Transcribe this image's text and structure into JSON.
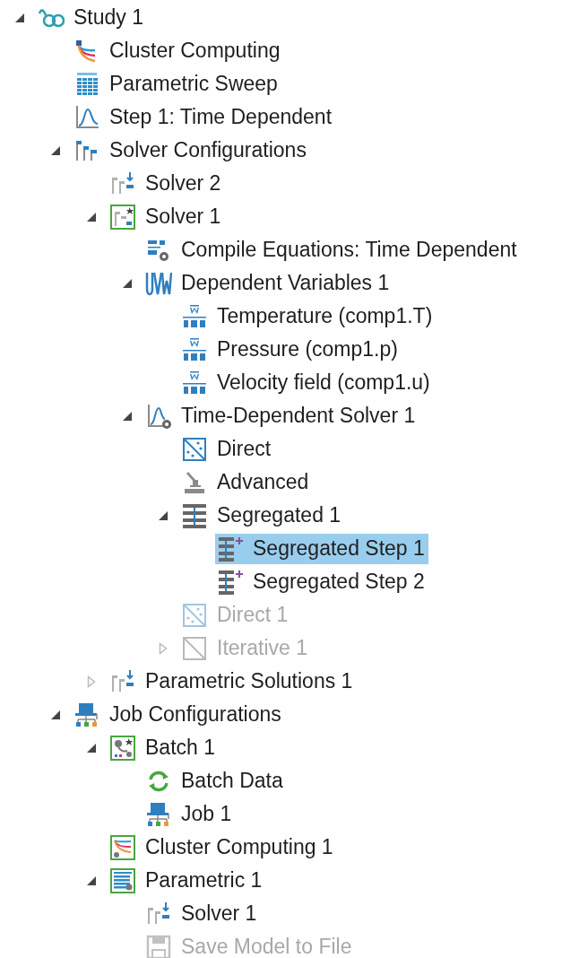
{
  "tree": [
    {
      "label": "Study 1",
      "kind": "study",
      "expanded": true,
      "selected": false,
      "disabled": false,
      "children": [
        {
          "label": "Cluster Computing",
          "kind": "cluster",
          "selected": false,
          "disabled": false
        },
        {
          "label": "Parametric Sweep",
          "kind": "sweep",
          "selected": false,
          "disabled": false
        },
        {
          "label": "Step 1: Time Dependent",
          "kind": "step",
          "selected": false,
          "disabled": false
        },
        {
          "label": "Solver Configurations",
          "kind": "solver-config",
          "expanded": true,
          "selected": false,
          "disabled": false,
          "children": [
            {
              "label": "Solver 2",
              "kind": "solver-ref",
              "selected": false,
              "disabled": false
            },
            {
              "label": "Solver 1",
              "kind": "solver",
              "expanded": true,
              "selected": false,
              "disabled": false,
              "children": [
                {
                  "label": "Compile Equations: Time Dependent",
                  "kind": "compile",
                  "selected": false,
                  "disabled": false
                },
                {
                  "label": "Dependent Variables 1",
                  "kind": "dep-vars",
                  "expanded": true,
                  "selected": false,
                  "disabled": false,
                  "children": [
                    {
                      "label": "Temperature (comp1.T)",
                      "kind": "field",
                      "selected": false,
                      "disabled": false
                    },
                    {
                      "label": "Pressure (comp1.p)",
                      "kind": "field",
                      "selected": false,
                      "disabled": false
                    },
                    {
                      "label": "Velocity field (comp1.u)",
                      "kind": "field",
                      "selected": false,
                      "disabled": false
                    }
                  ]
                },
                {
                  "label": "Time-Dependent Solver 1",
                  "kind": "time-solver",
                  "expanded": true,
                  "selected": false,
                  "disabled": false,
                  "children": [
                    {
                      "label": "Direct",
                      "kind": "direct",
                      "selected": false,
                      "disabled": false
                    },
                    {
                      "label": "Advanced",
                      "kind": "advanced",
                      "selected": false,
                      "disabled": false
                    },
                    {
                      "label": "Segregated 1",
                      "kind": "segregated",
                      "expanded": true,
                      "selected": false,
                      "disabled": false,
                      "children": [
                        {
                          "label": "Segregated Step 1",
                          "kind": "seg-step",
                          "selected": true,
                          "disabled": false
                        },
                        {
                          "label": "Segregated Step 2",
                          "kind": "seg-step",
                          "selected": false,
                          "disabled": false
                        }
                      ]
                    },
                    {
                      "label": "Direct 1",
                      "kind": "direct",
                      "selected": false,
                      "disabled": true
                    },
                    {
                      "label": "Iterative 1",
                      "kind": "iterative",
                      "expanded": false,
                      "selected": false,
                      "disabled": true
                    }
                  ]
                }
              ]
            },
            {
              "label": "Parametric Solutions 1",
              "kind": "solver-ref",
              "expanded": false,
              "selected": false,
              "disabled": false
            }
          ]
        },
        {
          "label": "Job Configurations",
          "kind": "job",
          "expanded": true,
          "selected": false,
          "disabled": false,
          "children": [
            {
              "label": "Batch 1",
              "kind": "batch",
              "expanded": true,
              "selected": false,
              "disabled": false,
              "children": [
                {
                  "label": "Batch Data",
                  "kind": "batch-data",
                  "selected": false,
                  "disabled": false
                },
                {
                  "label": "Job 1",
                  "kind": "job",
                  "selected": false,
                  "disabled": false
                }
              ]
            },
            {
              "label": "Cluster Computing 1",
              "kind": "cluster-box",
              "selected": false,
              "disabled": false
            },
            {
              "label": "Parametric 1",
              "kind": "parametric-box",
              "expanded": true,
              "selected": false,
              "disabled": false,
              "children": [
                {
                  "label": "Solver 1",
                  "kind": "solver-ref",
                  "selected": false,
                  "disabled": false
                },
                {
                  "label": "Save Model to File",
                  "kind": "save",
                  "selected": false,
                  "disabled": true
                }
              ]
            }
          ]
        }
      ]
    }
  ]
}
